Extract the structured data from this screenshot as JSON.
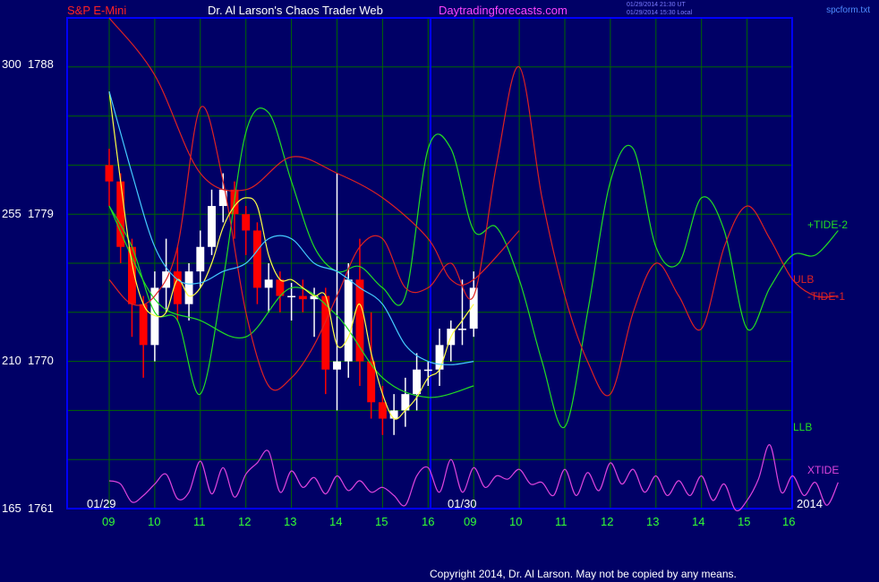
{
  "header": {
    "symbol": "S&P E-Mini",
    "author": "Dr. Al Larson's Chaos Trader Web",
    "website": "Daytradingforecasts.com",
    "timestamp_utc": "01/29/2014 21:30 UT",
    "timestamp_local": "01/29/2014 15:30 Local",
    "filename": "spcform.txt"
  },
  "footer": {
    "copyright": "Copyright 2014, Dr. Al Larson. May not be copied by any means."
  },
  "colors": {
    "background": "#000066",
    "frame": "#0000ff",
    "grid": "#006600",
    "symbol": "#ff2222",
    "author": "#ffffff",
    "website": "#ff44ff",
    "tide2": "#22dd22",
    "tide1": "#dd2222",
    "xtide": "#dd44dd",
    "candle_up": "#ffffff",
    "candle_down": "#ff0000",
    "fast_ma": "#ffff44",
    "slow_ma": "#44ccff"
  },
  "chart_data": {
    "type": "line",
    "title": "S&P E-Mini",
    "y_labels": [
      {
        "left": "300",
        "right": "1788",
        "value": 1788
      },
      {
        "left": "255",
        "right": "1779",
        "value": 1779
      },
      {
        "left": "210",
        "right": "1770",
        "value": 1770
      },
      {
        "left": "165",
        "right": "1761",
        "value": 1761
      }
    ],
    "ylim": [
      1761,
      1791
    ],
    "x_hour_labels": [
      "09",
      "10",
      "11",
      "12",
      "13",
      "14",
      "15",
      "16",
      "09",
      "10",
      "11",
      "12",
      "13",
      "14",
      "15",
      "16"
    ],
    "date_labels": [
      "01/29",
      "01/30",
      "2014"
    ],
    "series_labels": {
      "tide2": "+TIDE-2",
      "ulb": "ULB",
      "tide1": "-TIDE-1",
      "llb": "LLB",
      "xtide": "XTIDE"
    },
    "forecast_split_label": "01/30",
    "series": [
      {
        "name": "+TIDE-2",
        "x": [
          0,
          0.5,
          1,
          1.5,
          2,
          2.5,
          3,
          3.5,
          4,
          4.5,
          5,
          5.5,
          6,
          6.5,
          7,
          7.5,
          8,
          8.5,
          9,
          9.5,
          10,
          10.5,
          11,
          11.5,
          12,
          12.5,
          13,
          13.5,
          14,
          14.5,
          15,
          15.5,
          16
        ],
        "y": [
          1779.5,
          1777.0,
          1773.0,
          1772.5,
          1768.0,
          1775.0,
          1784.0,
          1785.2,
          1781.0,
          1777.0,
          1775.5,
          1775.8,
          1774.5,
          1774.0,
          1783.0,
          1783.0,
          1778.0,
          1778.2,
          1775.0,
          1770.0,
          1766.0,
          1773.0,
          1781.0,
          1783.0,
          1777.0,
          1776.0,
          1780.0,
          1778.0,
          1772.0,
          1774.5,
          1776.5,
          1776.5,
          1778.0
        ]
      },
      {
        "name": "ULB",
        "x": [
          0,
          1,
          2,
          3,
          4,
          5,
          6,
          7,
          7.5,
          8,
          9
        ],
        "y": [
          1791.0,
          1787.5,
          1781.5,
          1780.5,
          1782.5,
          1781.5,
          1780.0,
          1777.5,
          1775.0,
          1775.0,
          1778.0
        ]
      },
      {
        "name": "LLB",
        "x": [
          0,
          1,
          2,
          3,
          4,
          5,
          6,
          7,
          8
        ],
        "y": [
          1779.5,
          1773.8,
          1772.5,
          1771.5,
          1774.5,
          1772.8,
          1769.0,
          1767.8,
          1768.5
        ]
      },
      {
        "name": "-TIDE-1",
        "x": [
          0,
          0.5,
          1,
          1.5,
          2,
          2.5,
          3,
          3.5,
          4,
          4.5,
          5,
          5.5,
          6,
          6.5,
          7,
          7.5,
          8,
          8.5,
          9,
          9.5,
          10,
          10.5,
          11,
          11.5,
          12,
          12.5,
          13,
          13.5,
          14,
          14.5,
          15,
          15.5,
          16
        ],
        "y": [
          1775.0,
          1773.5,
          1774.0,
          1777.0,
          1785.5,
          1781.0,
          1773.0,
          1768.5,
          1769.0,
          1771.0,
          1774.0,
          1777.0,
          1777.5,
          1774.5,
          1774.5,
          1776.0,
          1774.0,
          1782.0,
          1788.0,
          1780.0,
          1774.0,
          1770.0,
          1768.0,
          1773.0,
          1776.0,
          1774.0,
          1772.0,
          1777.0,
          1779.5,
          1777.5,
          1775.0,
          1774.0,
          1774.0
        ]
      },
      {
        "name": "XTIDE",
        "x": [
          0,
          0.25,
          0.5,
          0.75,
          1,
          1.25,
          1.5,
          1.75,
          2,
          2.25,
          2.5,
          2.75,
          3,
          3.25,
          3.5,
          3.75,
          4,
          4.25,
          4.5,
          4.75,
          5,
          5.25,
          5.5,
          5.75,
          6,
          6.25,
          6.5,
          6.75,
          7,
          7.25,
          7.5,
          7.75,
          8,
          8.25,
          8.5,
          8.75,
          9,
          9.25,
          9.5,
          9.75,
          10,
          10.25,
          10.5,
          10.75,
          11,
          11.25,
          11.5,
          11.75,
          12,
          12.25,
          12.5,
          12.75,
          13,
          13.25,
          13.5,
          13.75,
          14,
          14.25,
          14.5,
          14.75,
          15,
          15.25,
          15.5,
          15.75,
          16
        ],
        "y": [
          1762.7,
          1762.5,
          1761.4,
          1761.8,
          1762.5,
          1763.1,
          1761.6,
          1762.0,
          1763.9,
          1761.9,
          1763.5,
          1761.7,
          1763.1,
          1763.8,
          1764.5,
          1762.0,
          1763.3,
          1762.3,
          1762.9,
          1761.9,
          1763.0,
          1762.1,
          1762.7,
          1762.0,
          1762.3,
          1761.8,
          1761.2,
          1763.0,
          1763.5,
          1762.0,
          1764.0,
          1762.0,
          1763.5,
          1762.3,
          1763.0,
          1762.8,
          1763.4,
          1762.5,
          1762.6,
          1761.8,
          1763.4,
          1761.8,
          1763.2,
          1762.1,
          1763.8,
          1762.5,
          1763.4,
          1762.0,
          1763.0,
          1761.8,
          1762.7,
          1761.8,
          1763.0,
          1761.5,
          1762.5,
          1760.9,
          1761.5,
          1762.8,
          1764.9,
          1762.0,
          1763.0,
          1761.8,
          1762.6,
          1761.2,
          1762.6
        ]
      },
      {
        "name": "Fast MA",
        "x": [
          0,
          0.25,
          0.5,
          0.75,
          1,
          1.25,
          1.5,
          1.75,
          2,
          2.25,
          2.5,
          2.75,
          3,
          3.25,
          3.5,
          3.75,
          4,
          4.25,
          4.5,
          4.75,
          5,
          5.25,
          5.5,
          5.75,
          6,
          6.25,
          6.5,
          6.75,
          7,
          7.25,
          7.5,
          7.75,
          8
        ],
        "y": [
          1786.5,
          1781.0,
          1776.0,
          1773.5,
          1772.8,
          1773.0,
          1775.0,
          1774.0,
          1774.5,
          1776.0,
          1778.2,
          1779.5,
          1780.0,
          1779.5,
          1776.5,
          1775.0,
          1775.0,
          1774.5,
          1774.0,
          1774.0,
          1771.0,
          1771.5,
          1773.5,
          1770.5,
          1768.0,
          1766.5,
          1767.0,
          1767.8,
          1769.0,
          1769.5,
          1771.5,
          1772.5,
          1773.5
        ]
      },
      {
        "name": "Slow MA",
        "x": [
          0,
          0.5,
          1,
          1.5,
          2,
          2.5,
          3,
          3.5,
          4,
          4.5,
          5,
          5.5,
          6,
          6.5,
          7,
          7.5,
          8
        ],
        "y": [
          1786.5,
          1781.5,
          1777.0,
          1775.0,
          1774.8,
          1775.5,
          1776.0,
          1777.5,
          1777.5,
          1776.0,
          1775.5,
          1774.5,
          1773.5,
          1771.0,
          1770.0,
          1769.8,
          1770.0
        ]
      }
    ],
    "price_bars": {
      "x": [
        0,
        0.25,
        0.5,
        0.75,
        1,
        1.25,
        1.5,
        1.75,
        2,
        2.25,
        2.5,
        2.75,
        3,
        3.25,
        3.5,
        3.75,
        4,
        4.25,
        4.5,
        4.75,
        5,
        5.25,
        5.5,
        5.75,
        6,
        6.25,
        6.5,
        6.75,
        7,
        7.25,
        7.5,
        7.75,
        8
      ],
      "open": [
        1782.0,
        1781.0,
        1777.0,
        1773.5,
        1771.0,
        1774.5,
        1775.5,
        1773.5,
        1775.5,
        1777.0,
        1779.5,
        1780.5,
        1779.0,
        1778.0,
        1774.5,
        1775.0,
        1774.0,
        1774.0,
        1773.8,
        1774.0,
        1769.5,
        1770.0,
        1775.0,
        1770.0,
        1767.5,
        1766.5,
        1767.0,
        1768.0,
        1769.5,
        1769.5,
        1771.0,
        1772.0,
        1772.0
      ],
      "close": [
        1781.0,
        1777.0,
        1773.5,
        1771.0,
        1774.5,
        1775.5,
        1773.5,
        1775.5,
        1777.0,
        1779.5,
        1780.5,
        1779.0,
        1778.0,
        1774.5,
        1775.0,
        1774.0,
        1774.0,
        1773.8,
        1774.0,
        1769.5,
        1770.0,
        1775.0,
        1770.0,
        1767.5,
        1766.5,
        1767.0,
        1768.0,
        1769.5,
        1769.5,
        1771.0,
        1772.0,
        1772.0,
        1774.5
      ],
      "high": [
        1783.0,
        1781.5,
        1777.5,
        1774.0,
        1775.5,
        1777.5,
        1777.0,
        1776.0,
        1778.0,
        1780.5,
        1781.5,
        1781.0,
        1779.5,
        1778.5,
        1776.0,
        1775.5,
        1774.8,
        1775.0,
        1774.5,
        1774.5,
        1781.5,
        1776.0,
        1777.5,
        1773.0,
        1768.5,
        1768.0,
        1769.0,
        1770.5,
        1770.0,
        1772.0,
        1772.5,
        1775.0,
        1775.5
      ],
      "low": [
        1779.5,
        1776.0,
        1771.5,
        1769.0,
        1770.0,
        1773.0,
        1772.5,
        1772.5,
        1774.5,
        1776.5,
        1778.5,
        1777.5,
        1776.5,
        1773.5,
        1773.0,
        1773.0,
        1772.5,
        1773.0,
        1771.5,
        1768.0,
        1767.0,
        1769.0,
        1768.5,
        1766.5,
        1765.5,
        1765.5,
        1766.0,
        1767.0,
        1768.5,
        1768.5,
        1770.0,
        1771.0,
        1771.5
      ]
    }
  }
}
